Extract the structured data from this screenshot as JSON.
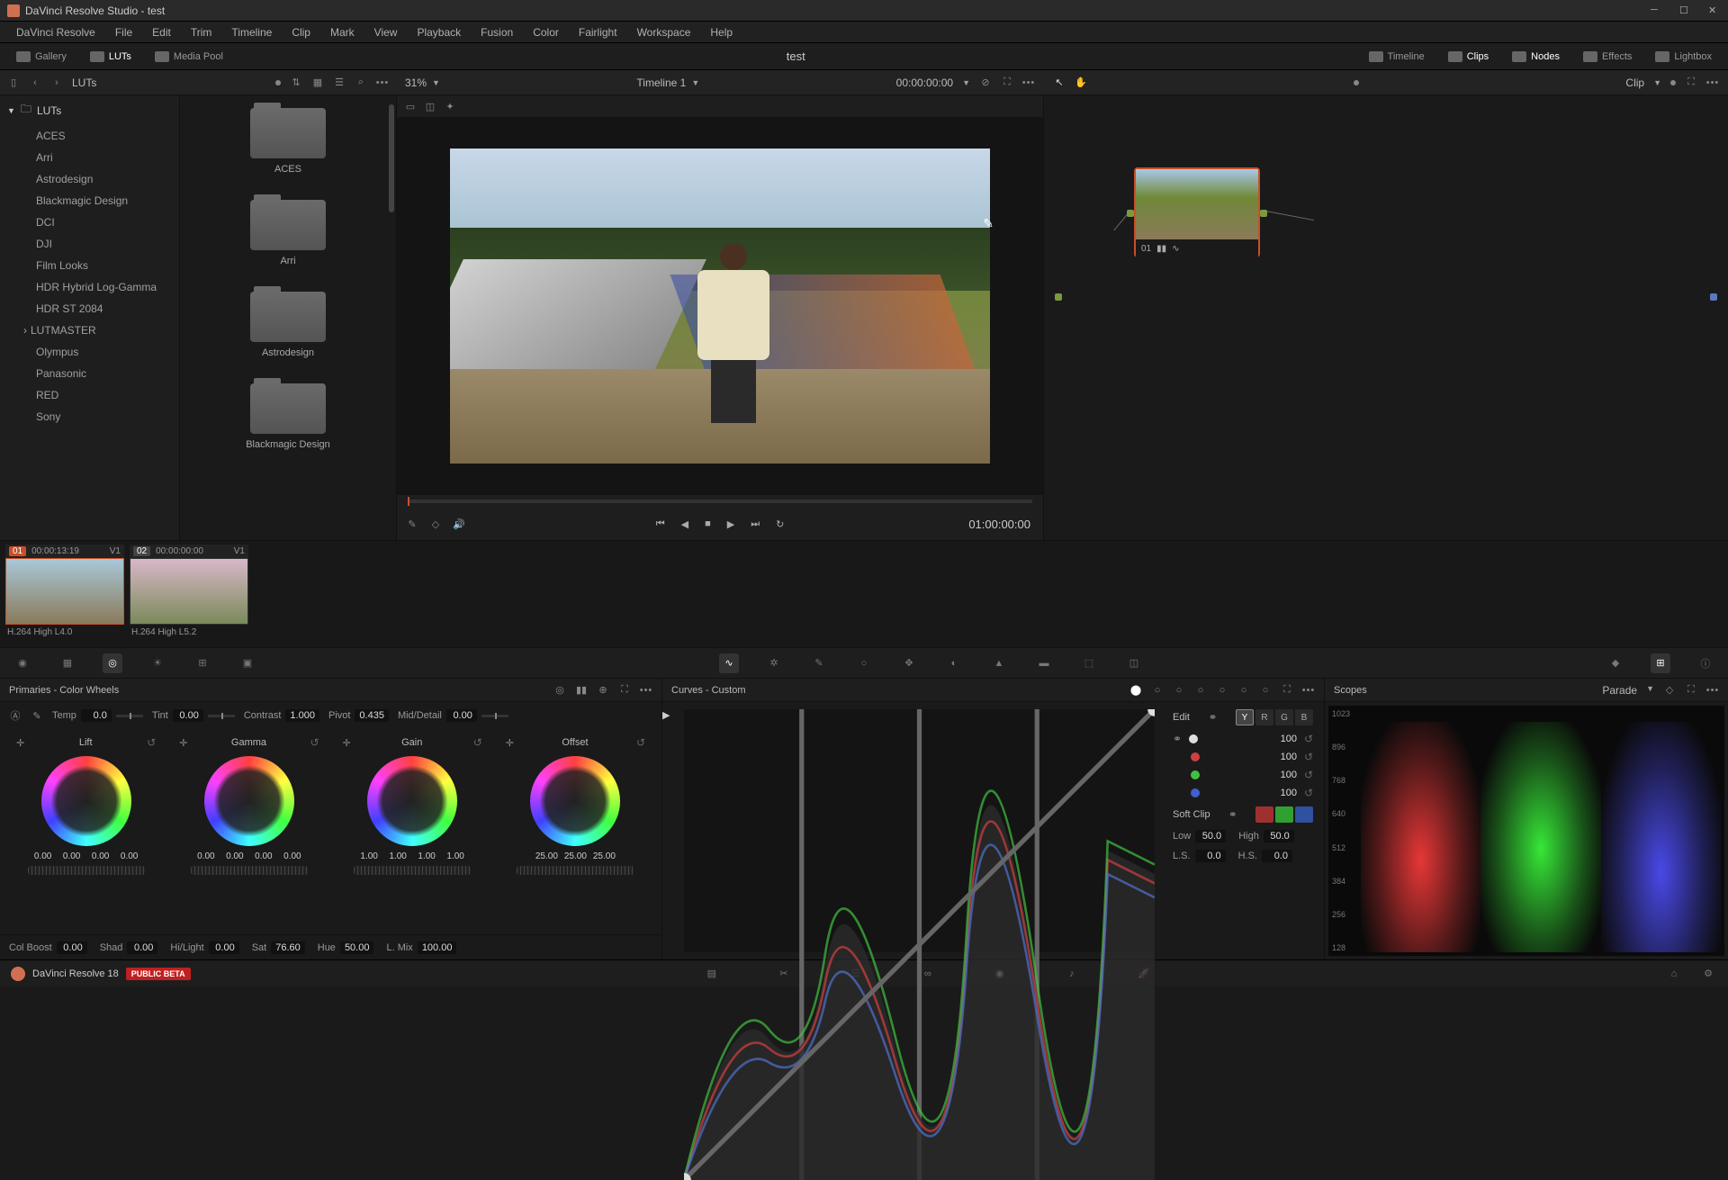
{
  "window": {
    "title": "DaVinci Resolve Studio - test"
  },
  "menu": [
    "DaVinci Resolve",
    "File",
    "Edit",
    "Trim",
    "Timeline",
    "Clip",
    "Mark",
    "View",
    "Playback",
    "Fusion",
    "Color",
    "Fairlight",
    "Workspace",
    "Help"
  ],
  "toolbar": {
    "left": [
      {
        "label": "Gallery",
        "icon": "gallery-icon"
      },
      {
        "label": "LUTs",
        "icon": "luts-icon",
        "active": true
      },
      {
        "label": "Media Pool",
        "icon": "mediapool-icon"
      }
    ],
    "center_title": "test",
    "right": [
      {
        "label": "Timeline",
        "icon": "timeline-icon"
      },
      {
        "label": "Clips",
        "icon": "clips-icon",
        "active": true
      },
      {
        "label": "Nodes",
        "icon": "nodes-icon",
        "active": true
      },
      {
        "label": "Effects",
        "icon": "effects-icon"
      },
      {
        "label": "Lightbox",
        "icon": "lightbox-icon"
      }
    ]
  },
  "sub": {
    "luts_title": "LUTs",
    "zoom_pct": "31%",
    "timeline_label": "Timeline 1",
    "timecode": "00:00:00:00",
    "clip_label": "Clip"
  },
  "luts_tree": {
    "root": "LUTs",
    "items": [
      "ACES",
      "Arri",
      "Astrodesign",
      "Blackmagic Design",
      "DCI",
      "DJI",
      "Film Looks",
      "HDR Hybrid Log-Gamma",
      "HDR ST 2084",
      "LUTMASTER",
      "Olympus",
      "Panasonic",
      "RED",
      "Sony"
    ]
  },
  "luts_folders": [
    "ACES",
    "Arri",
    "Astrodesign",
    "Blackmagic Design"
  ],
  "viewer": {
    "record_tc": "01:00:00:00"
  },
  "node": {
    "number": "01"
  },
  "clips": [
    {
      "idx": "01",
      "tc": "00:00:13:19",
      "track": "V1",
      "label": "H.264 High L4.0",
      "active": true
    },
    {
      "idx": "02",
      "tc": "00:00:00:00",
      "track": "V1",
      "label": "H.264 High L5.2",
      "active": false
    }
  ],
  "primaries": {
    "title": "Primaries - Color Wheels",
    "temp": {
      "label": "Temp",
      "value": "0.0"
    },
    "tint": {
      "label": "Tint",
      "value": "0.00"
    },
    "contrast": {
      "label": "Contrast",
      "value": "1.000"
    },
    "pivot": {
      "label": "Pivot",
      "value": "0.435"
    },
    "middetail": {
      "label": "Mid/Detail",
      "value": "0.00"
    },
    "wheels": [
      {
        "name": "Lift",
        "vals": [
          "0.00",
          "0.00",
          "0.00",
          "0.00"
        ]
      },
      {
        "name": "Gamma",
        "vals": [
          "0.00",
          "0.00",
          "0.00",
          "0.00"
        ]
      },
      {
        "name": "Gain",
        "vals": [
          "1.00",
          "1.00",
          "1.00",
          "1.00"
        ]
      },
      {
        "name": "Offset",
        "vals": [
          "25.00",
          "25.00",
          "25.00"
        ]
      }
    ],
    "colboost": {
      "label": "Col Boost",
      "value": "0.00"
    },
    "shad": {
      "label": "Shad",
      "value": "0.00"
    },
    "hilight": {
      "label": "Hi/Light",
      "value": "0.00"
    },
    "sat": {
      "label": "Sat",
      "value": "76.60"
    },
    "hue": {
      "label": "Hue",
      "value": "50.00"
    },
    "lmix": {
      "label": "L. Mix",
      "value": "100.00"
    }
  },
  "curves": {
    "title": "Curves - Custom",
    "edit_label": "Edit",
    "channels": [
      "Y",
      "R",
      "G",
      "B"
    ],
    "intensities": [
      "100",
      "100",
      "100",
      "100"
    ],
    "softclip_label": "Soft Clip",
    "low": {
      "label": "Low",
      "value": "50.0"
    },
    "high": {
      "label": "High",
      "value": "50.0"
    },
    "ls": {
      "label": "L.S.",
      "value": "0.0"
    },
    "hs": {
      "label": "H.S.",
      "value": "0.0"
    }
  },
  "scopes": {
    "title": "Scopes",
    "mode": "Parade",
    "scale": [
      "1023",
      "896",
      "768",
      "640",
      "512",
      "384",
      "256",
      "128"
    ]
  },
  "footer": {
    "app": "DaVinci Resolve 18",
    "badge": "PUBLIC BETA"
  }
}
